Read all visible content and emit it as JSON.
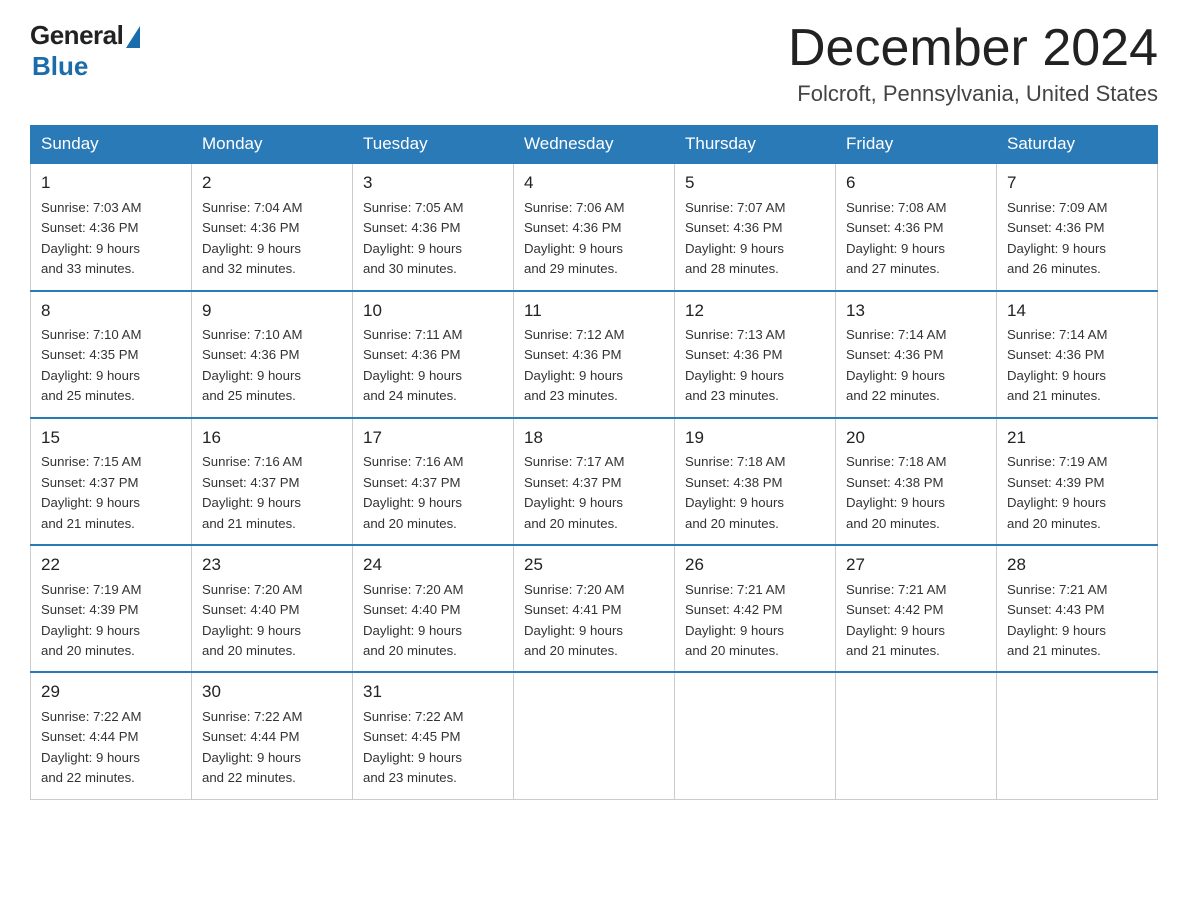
{
  "header": {
    "logo_general": "General",
    "logo_blue": "Blue",
    "month_title": "December 2024",
    "location": "Folcroft, Pennsylvania, United States"
  },
  "weekdays": [
    "Sunday",
    "Monday",
    "Tuesday",
    "Wednesday",
    "Thursday",
    "Friday",
    "Saturday"
  ],
  "weeks": [
    [
      {
        "day": "1",
        "sunrise": "7:03 AM",
        "sunset": "4:36 PM",
        "daylight": "9 hours and 33 minutes."
      },
      {
        "day": "2",
        "sunrise": "7:04 AM",
        "sunset": "4:36 PM",
        "daylight": "9 hours and 32 minutes."
      },
      {
        "day": "3",
        "sunrise": "7:05 AM",
        "sunset": "4:36 PM",
        "daylight": "9 hours and 30 minutes."
      },
      {
        "day": "4",
        "sunrise": "7:06 AM",
        "sunset": "4:36 PM",
        "daylight": "9 hours and 29 minutes."
      },
      {
        "day": "5",
        "sunrise": "7:07 AM",
        "sunset": "4:36 PM",
        "daylight": "9 hours and 28 minutes."
      },
      {
        "day": "6",
        "sunrise": "7:08 AM",
        "sunset": "4:36 PM",
        "daylight": "9 hours and 27 minutes."
      },
      {
        "day": "7",
        "sunrise": "7:09 AM",
        "sunset": "4:36 PM",
        "daylight": "9 hours and 26 minutes."
      }
    ],
    [
      {
        "day": "8",
        "sunrise": "7:10 AM",
        "sunset": "4:35 PM",
        "daylight": "9 hours and 25 minutes."
      },
      {
        "day": "9",
        "sunrise": "7:10 AM",
        "sunset": "4:36 PM",
        "daylight": "9 hours and 25 minutes."
      },
      {
        "day": "10",
        "sunrise": "7:11 AM",
        "sunset": "4:36 PM",
        "daylight": "9 hours and 24 minutes."
      },
      {
        "day": "11",
        "sunrise": "7:12 AM",
        "sunset": "4:36 PM",
        "daylight": "9 hours and 23 minutes."
      },
      {
        "day": "12",
        "sunrise": "7:13 AM",
        "sunset": "4:36 PM",
        "daylight": "9 hours and 23 minutes."
      },
      {
        "day": "13",
        "sunrise": "7:14 AM",
        "sunset": "4:36 PM",
        "daylight": "9 hours and 22 minutes."
      },
      {
        "day": "14",
        "sunrise": "7:14 AM",
        "sunset": "4:36 PM",
        "daylight": "9 hours and 21 minutes."
      }
    ],
    [
      {
        "day": "15",
        "sunrise": "7:15 AM",
        "sunset": "4:37 PM",
        "daylight": "9 hours and 21 minutes."
      },
      {
        "day": "16",
        "sunrise": "7:16 AM",
        "sunset": "4:37 PM",
        "daylight": "9 hours and 21 minutes."
      },
      {
        "day": "17",
        "sunrise": "7:16 AM",
        "sunset": "4:37 PM",
        "daylight": "9 hours and 20 minutes."
      },
      {
        "day": "18",
        "sunrise": "7:17 AM",
        "sunset": "4:37 PM",
        "daylight": "9 hours and 20 minutes."
      },
      {
        "day": "19",
        "sunrise": "7:18 AM",
        "sunset": "4:38 PM",
        "daylight": "9 hours and 20 minutes."
      },
      {
        "day": "20",
        "sunrise": "7:18 AM",
        "sunset": "4:38 PM",
        "daylight": "9 hours and 20 minutes."
      },
      {
        "day": "21",
        "sunrise": "7:19 AM",
        "sunset": "4:39 PM",
        "daylight": "9 hours and 20 minutes."
      }
    ],
    [
      {
        "day": "22",
        "sunrise": "7:19 AM",
        "sunset": "4:39 PM",
        "daylight": "9 hours and 20 minutes."
      },
      {
        "day": "23",
        "sunrise": "7:20 AM",
        "sunset": "4:40 PM",
        "daylight": "9 hours and 20 minutes."
      },
      {
        "day": "24",
        "sunrise": "7:20 AM",
        "sunset": "4:40 PM",
        "daylight": "9 hours and 20 minutes."
      },
      {
        "day": "25",
        "sunrise": "7:20 AM",
        "sunset": "4:41 PM",
        "daylight": "9 hours and 20 minutes."
      },
      {
        "day": "26",
        "sunrise": "7:21 AM",
        "sunset": "4:42 PM",
        "daylight": "9 hours and 20 minutes."
      },
      {
        "day": "27",
        "sunrise": "7:21 AM",
        "sunset": "4:42 PM",
        "daylight": "9 hours and 21 minutes."
      },
      {
        "day": "28",
        "sunrise": "7:21 AM",
        "sunset": "4:43 PM",
        "daylight": "9 hours and 21 minutes."
      }
    ],
    [
      {
        "day": "29",
        "sunrise": "7:22 AM",
        "sunset": "4:44 PM",
        "daylight": "9 hours and 22 minutes."
      },
      {
        "day": "30",
        "sunrise": "7:22 AM",
        "sunset": "4:44 PM",
        "daylight": "9 hours and 22 minutes."
      },
      {
        "day": "31",
        "sunrise": "7:22 AM",
        "sunset": "4:45 PM",
        "daylight": "9 hours and 23 minutes."
      },
      null,
      null,
      null,
      null
    ]
  ],
  "labels": {
    "sunrise": "Sunrise:",
    "sunset": "Sunset:",
    "daylight": "Daylight:"
  }
}
